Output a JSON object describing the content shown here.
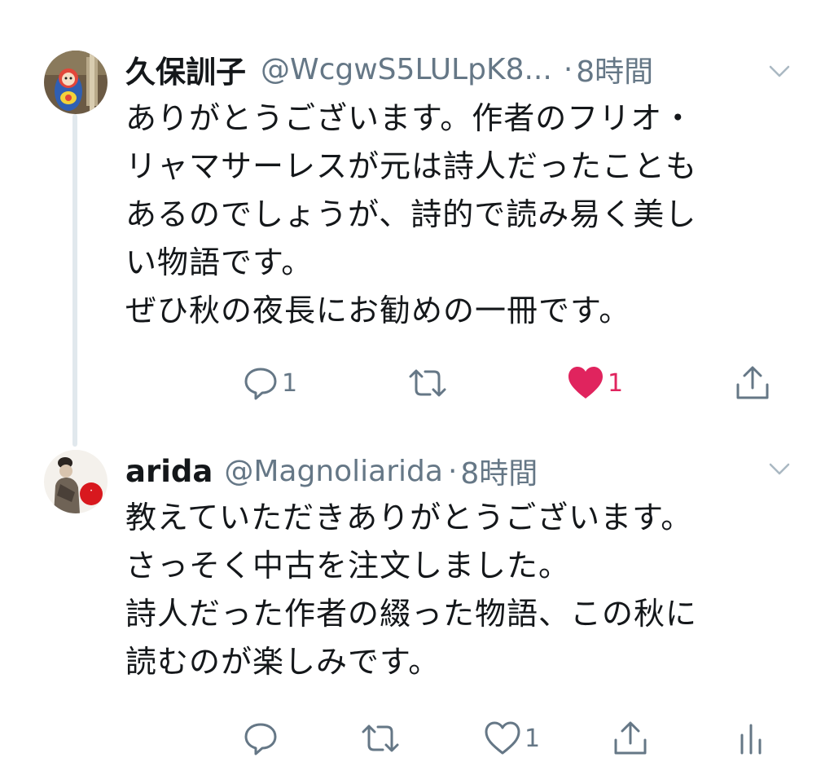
{
  "tweets": [
    {
      "name": "久保訓子",
      "handle": "@WcgwS5LULpK8...",
      "separator": "·",
      "time": "8時間",
      "body": [
        "ありがとうございます。作者のフリオ・",
        "リャマサーレスが元は詩人だったことも",
        "あるのでしょうが、詩的で読み易く美し",
        "い物語です。",
        "ぜひ秋の夜長にお勧めの一冊です。"
      ],
      "actions": {
        "reply_count": "1",
        "retweet_count": "",
        "like_count": "1",
        "liked": true
      },
      "avatar_icon": "matryoshka-doll-avatar"
    },
    {
      "name": "arida",
      "handle": "@Magnoliarida",
      "separator": "·",
      "time": "8時間",
      "body": [
        "教えていただきありがとうございます。",
        "さっそく中古を注文しました。",
        "詩人だった作者の綴った物語、この秋に",
        "読むのが楽しみです。"
      ],
      "actions": {
        "reply_count": "",
        "retweet_count": "",
        "like_count": "1",
        "liked": false
      },
      "avatar_icon": "person-avatar"
    }
  ],
  "colors": {
    "secondary": "#657786",
    "like": "#e0245e",
    "thread_line": "#e1e8ed",
    "text": "#14171a"
  }
}
